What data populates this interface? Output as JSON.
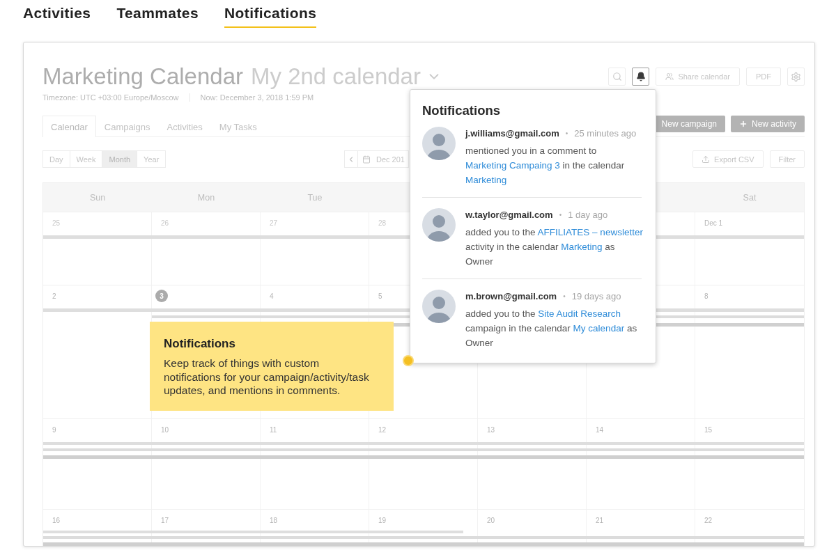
{
  "tabs": [
    {
      "label": "Activities",
      "selected": false
    },
    {
      "label": "Teammates",
      "selected": false
    },
    {
      "label": "Notifications",
      "selected": true
    }
  ],
  "calendar": {
    "title": "Marketing Calendar",
    "calendar_switch": {
      "label": "My 2nd calendar",
      "expanded": false
    },
    "timezone": "Timezone: UTC +03:00 Europe/Moscow",
    "now": "Now: December 3, 2018 1:59 PM",
    "toolbar": [
      {
        "kind": "search",
        "active": false
      },
      {
        "kind": "bell",
        "active": true
      },
      {
        "kind": "share",
        "label": "Share calendar",
        "active": false
      },
      {
        "kind": "text",
        "label": "PDF",
        "active": false
      },
      {
        "kind": "gear",
        "active": false
      }
    ],
    "tabs": [
      {
        "label": "Calendar",
        "selected": true
      },
      {
        "label": "Campaigns",
        "selected": false
      },
      {
        "label": "Activities",
        "selected": false
      },
      {
        "label": "My Tasks",
        "selected": false
      }
    ],
    "actions": [
      {
        "kind": "plain",
        "label": "New campaign"
      },
      {
        "kind": "add",
        "label": "New activity"
      }
    ],
    "views": [
      {
        "label": "Day",
        "selected": false
      },
      {
        "label": "Week",
        "selected": false
      },
      {
        "label": "Month",
        "selected": true
      },
      {
        "label": "Year",
        "selected": false
      }
    ],
    "date_picker": {
      "value": "Dec 201"
    },
    "tools": [
      {
        "kind": "export",
        "label": "Export CSV"
      },
      {
        "kind": "plain",
        "label": "Filter"
      }
    ],
    "weekdays": {
      "sun": "Sun",
      "mon": "Mon",
      "tue": "Tue",
      "sat": "Sat"
    },
    "weeks": [
      {
        "days": {
          "sun": {
            "label": "25",
            "muted": true,
            "today": false
          },
          "mon": {
            "label": "26",
            "muted": true,
            "today": false
          },
          "tue": {
            "label": "27",
            "muted": true,
            "today": false
          },
          "wed": {
            "label": "28",
            "muted": true,
            "today": false
          },
          "sat": {
            "label": "Dec 1",
            "muted": false,
            "today": false
          }
        }
      },
      {
        "days": {
          "sun": {
            "label": "2",
            "muted": false,
            "today": false
          },
          "mon": {
            "label": "3",
            "muted": false,
            "today": true
          },
          "tue": {
            "label": "4",
            "muted": false,
            "today": false
          },
          "wed": {
            "label": "5",
            "muted": false,
            "today": false
          },
          "sat": {
            "label": "8",
            "muted": false,
            "today": false
          }
        }
      },
      {
        "days": {
          "sun": {
            "label": "9",
            "muted": false,
            "today": false
          },
          "mon": {
            "label": "10",
            "muted": false,
            "today": false
          },
          "tue": {
            "label": "11",
            "muted": false,
            "today": false
          },
          "wed": {
            "label": "12",
            "muted": false,
            "today": false
          },
          "thu": {
            "label": "13",
            "muted": false,
            "today": false
          },
          "fri": {
            "label": "14",
            "muted": false,
            "today": false
          },
          "sat": {
            "label": "15",
            "muted": false,
            "today": false
          }
        }
      },
      {
        "days": {
          "sun": {
            "label": "16",
            "muted": false,
            "today": false
          },
          "mon": {
            "label": "17",
            "muted": false,
            "today": false
          },
          "tue": {
            "label": "18",
            "muted": false,
            "today": false
          },
          "wed": {
            "label": "19",
            "muted": false,
            "today": false
          },
          "thu": {
            "label": "20",
            "muted": false,
            "today": false
          },
          "fri": {
            "label": "21",
            "muted": false,
            "today": false
          },
          "sat": {
            "label": "22",
            "muted": false,
            "today": false
          }
        }
      }
    ]
  },
  "notifications": {
    "title": "Notifications",
    "items": [
      {
        "author": "j.williams@gmail.com",
        "separator": "•",
        "time": "25 minutes ago",
        "message": [
          {
            "kind": "text",
            "text": "mentioned you in a comment to\n"
          },
          {
            "kind": "link",
            "text": "Marketing Campaing 3"
          },
          {
            "kind": "text",
            "text": " in the calendar\n"
          },
          {
            "kind": "link",
            "text": "Marketing"
          }
        ]
      },
      {
        "author": "w.taylor@gmail.com",
        "separator": "•",
        "time": "1 day ago",
        "message": [
          {
            "kind": "text",
            "text": "added you to the "
          },
          {
            "kind": "link",
            "text": "AFFILIATES – newsletter"
          },
          {
            "kind": "text",
            "text": "\nactivity in the calendar "
          },
          {
            "kind": "link",
            "text": "Marketing"
          },
          {
            "kind": "text",
            "text": " as\nOwner"
          }
        ]
      },
      {
        "author": "m.brown@gmail.com",
        "separator": "•",
        "time": "19 days ago",
        "message": [
          {
            "kind": "text",
            "text": "added you to the "
          },
          {
            "kind": "link",
            "text": "Site Audit Research"
          },
          {
            "kind": "text",
            "text": "\ncampaign in the calendar "
          },
          {
            "kind": "link",
            "text": "My calendar"
          },
          {
            "kind": "text",
            "text": " as\nOwner"
          }
        ]
      }
    ]
  },
  "tooltip": {
    "title": "Notifications",
    "text": "Keep track of things with custom\nnotifications for your campaign/activity/task\nupdates, and mentions in comments."
  }
}
